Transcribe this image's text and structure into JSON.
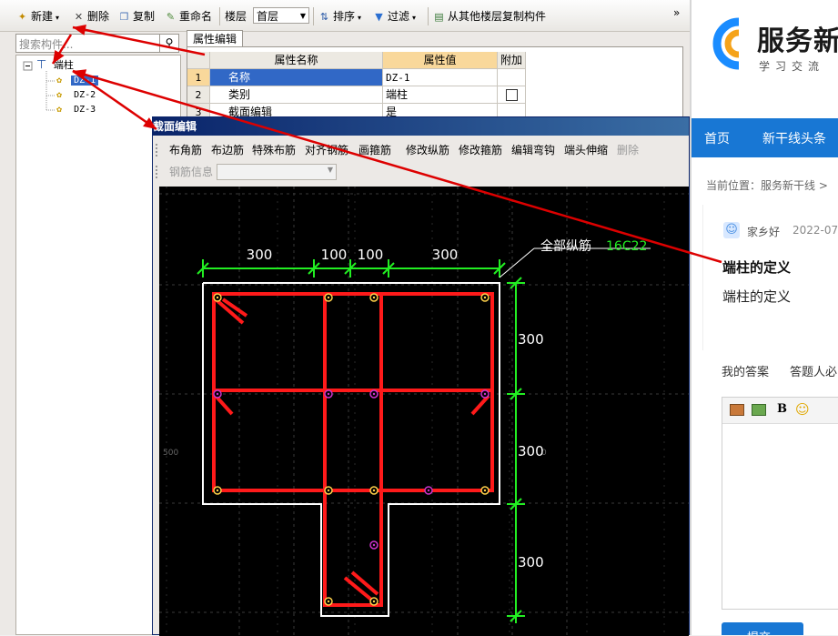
{
  "toolbar": {
    "new": "新建",
    "delete": "删除",
    "copy": "复制",
    "rename": "重命名",
    "floor_label": "楼层",
    "floor_value": "首层",
    "sort": "排序",
    "filter": "过滤",
    "copy_from_floor": "从其他楼层复制构件",
    "more": "»"
  },
  "tree": {
    "search_placeholder": "搜索构件...",
    "root": "端柱",
    "items": [
      "DZ-1",
      "DZ-2",
      "DZ-3"
    ]
  },
  "properties": {
    "tab": "属性编辑",
    "headers": [
      "属性名称",
      "属性值",
      "附加"
    ],
    "rows": [
      {
        "num": "1",
        "name": "名称",
        "value": "DZ-1"
      },
      {
        "num": "2",
        "name": "类别",
        "value": "端柱"
      },
      {
        "num": "3",
        "name": "截面编辑",
        "value": "是"
      }
    ]
  },
  "editor": {
    "title": "截面编辑",
    "tools": [
      "布角筋",
      "布边筋",
      "特殊布筋",
      "对齐钢筋",
      "画箍筋",
      "修改纵筋",
      "修改箍筋",
      "编辑弯钩",
      "端头伸缩",
      "删除"
    ],
    "rebar_info_label": "钢筋信息",
    "rebar_info_value": "",
    "annotation_label": "全部纵筋",
    "annotation_value": "16C22",
    "dims_top": [
      "300",
      "100",
      "100",
      "300"
    ],
    "dims_right": [
      "300",
      "300",
      "300"
    ],
    "grid_left": "500",
    "grid_right": "0"
  },
  "colors": {
    "rebar": "#ff1a1a",
    "dimension": "#22ee22",
    "outline": "#ffffff",
    "bar_dot": "#ffd24a",
    "bar_dot_mid": "#cc33cc",
    "arrow": "#dd0000",
    "nav": "#1877d4"
  },
  "web": {
    "logo": "服务新",
    "logo_sub": "学习交流",
    "nav": [
      "首页",
      "新干线头条"
    ],
    "breadcrumb": "当前位置：服务新干线 >",
    "user": "家乡好",
    "date": "2022-07-",
    "question_title": "端柱的定义",
    "question_body": "端柱的定义",
    "tabs": [
      "我的答案",
      "答题人必"
    ],
    "bold_tool": "B",
    "submit": "提交"
  }
}
